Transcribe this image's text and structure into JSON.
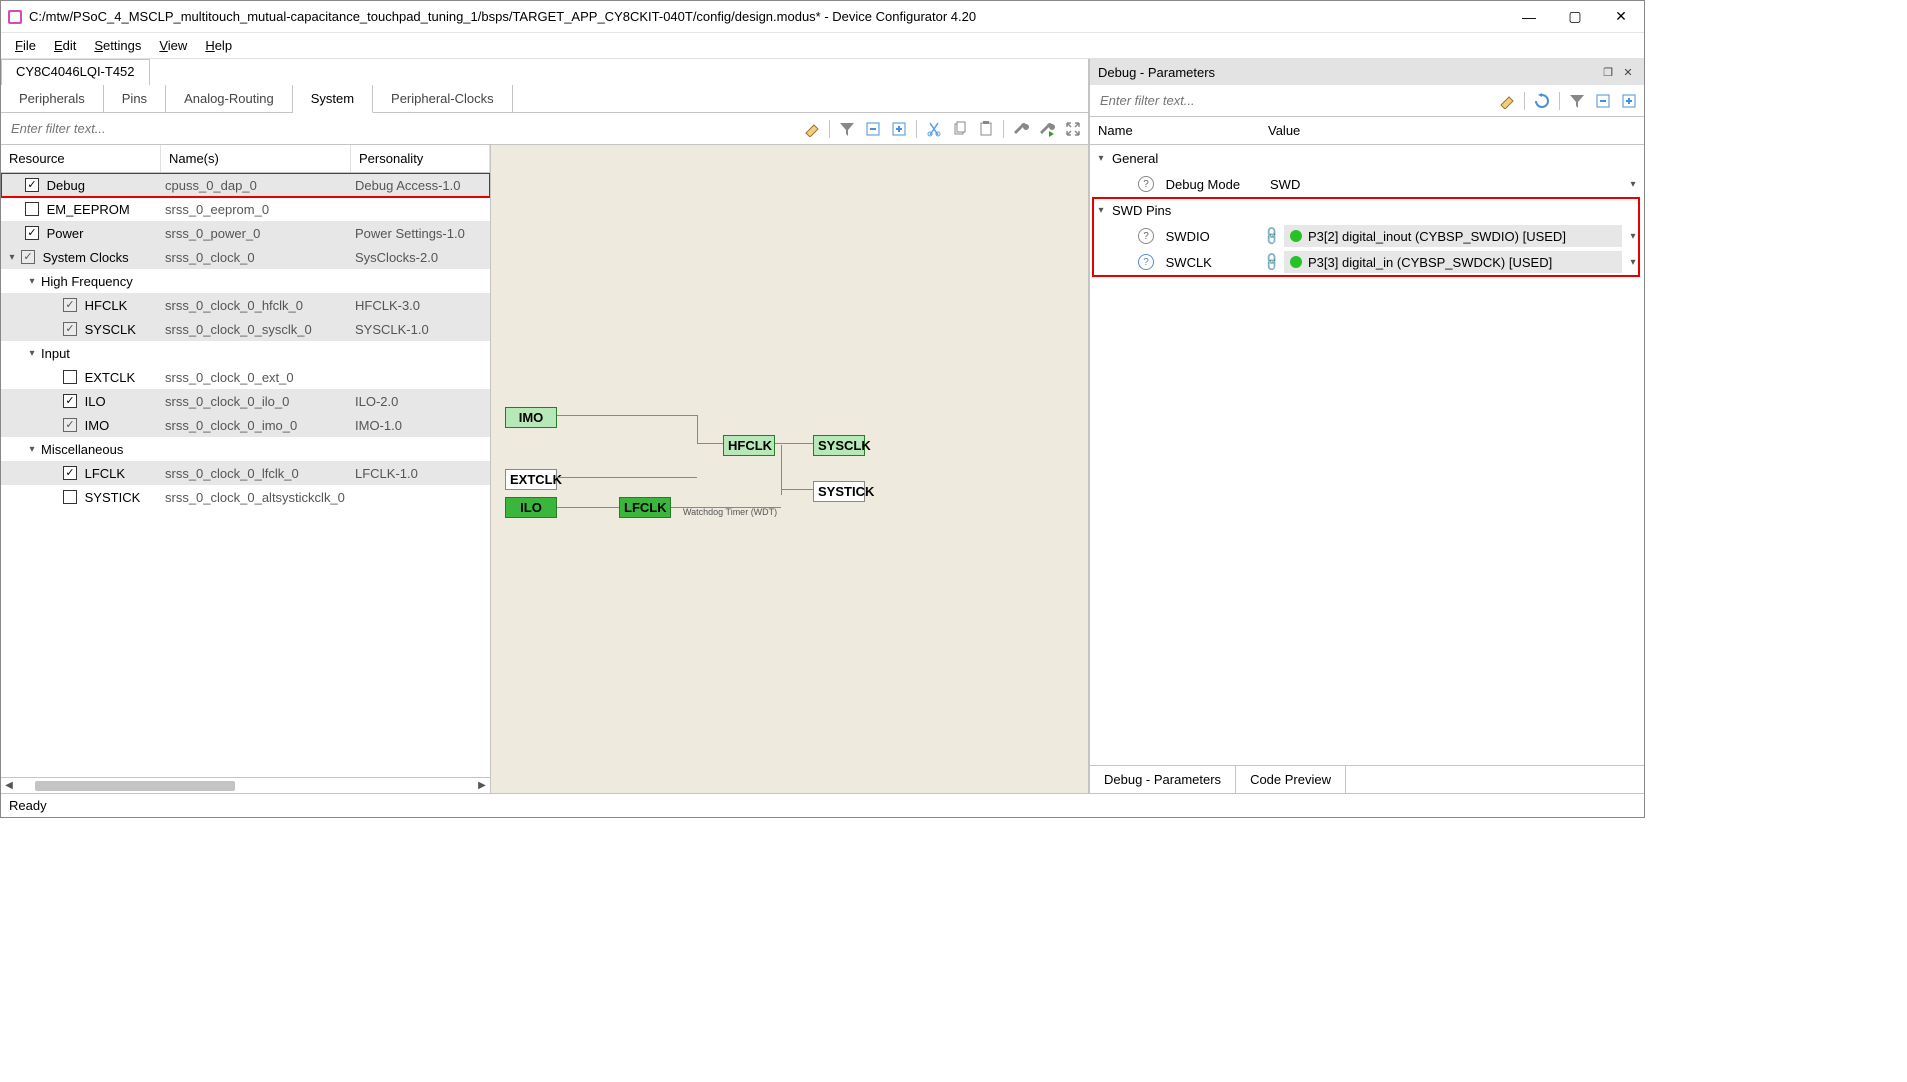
{
  "window": {
    "title": "C:/mtw/PSoC_4_MSCLP_multitouch_mutual-capacitance_touchpad_tuning_1/bsps/TARGET_APP_CY8CKIT-040T/config/design.modus* - Device Configurator 4.20"
  },
  "menubar": {
    "file": "File",
    "edit": "Edit",
    "settings": "Settings",
    "view": "View",
    "help": "Help"
  },
  "device_tab": "CY8C4046LQI-T452",
  "tabs": {
    "peripherals": "Peripherals",
    "pins": "Pins",
    "analog_routing": "Analog-Routing",
    "system": "System",
    "peripheral_clocks": "Peripheral-Clocks"
  },
  "left_filter_placeholder": "Enter filter text...",
  "tree_headers": {
    "resource": "Resource",
    "names": "Name(s)",
    "personality": "Personality"
  },
  "tree": {
    "debug": {
      "label": "Debug",
      "names": "cpuss_0_dap_0",
      "pers": "Debug Access-1.0"
    },
    "em_eeprom": {
      "label": "EM_EEPROM",
      "names": "srss_0_eeprom_0",
      "pers": ""
    },
    "power": {
      "label": "Power",
      "names": "srss_0_power_0",
      "pers": "Power Settings-1.0"
    },
    "system_clocks": {
      "label": "System Clocks",
      "names": "srss_0_clock_0",
      "pers": "SysClocks-2.0"
    },
    "high_freq": {
      "label": "High Frequency"
    },
    "hfclk": {
      "label": "HFCLK",
      "names": "srss_0_clock_0_hfclk_0",
      "pers": "HFCLK-3.0"
    },
    "sysclk": {
      "label": "SYSCLK",
      "names": "srss_0_clock_0_sysclk_0",
      "pers": "SYSCLK-1.0"
    },
    "input": {
      "label": "Input"
    },
    "extclk": {
      "label": "EXTCLK",
      "names": "srss_0_clock_0_ext_0",
      "pers": ""
    },
    "ilo": {
      "label": "ILO",
      "names": "srss_0_clock_0_ilo_0",
      "pers": "ILO-2.0"
    },
    "imo": {
      "label": "IMO",
      "names": "srss_0_clock_0_imo_0",
      "pers": "IMO-1.0"
    },
    "misc": {
      "label": "Miscellaneous"
    },
    "lfclk": {
      "label": "LFCLK",
      "names": "srss_0_clock_0_lfclk_0",
      "pers": "LFCLK-1.0"
    },
    "systick": {
      "label": "SYSTICK",
      "names": "srss_0_clock_0_altsystickclk_0",
      "pers": ""
    }
  },
  "canvas": {
    "imo": "IMO",
    "hfclk": "HFCLK",
    "sysclk": "SYSCLK",
    "extclk": "EXTCLK",
    "ilo": "ILO",
    "lfclk": "LFCLK",
    "systick": "SYSTICK",
    "wdt": "Watchdog Timer (WDT)"
  },
  "right": {
    "panel_title": "Debug - Parameters",
    "filter_placeholder": "Enter filter text...",
    "headers": {
      "name": "Name",
      "value": "Value"
    },
    "general": "General",
    "debug_mode_label": "Debug Mode",
    "debug_mode_value": "SWD",
    "swd_pins": "SWD Pins",
    "swdio_label": "SWDIO",
    "swdio_value": "P3[2] digital_inout (CYBSP_SWDIO) [USED]",
    "swclk_label": "SWCLK",
    "swclk_value": "P3[3] digital_in (CYBSP_SWDCK) [USED]",
    "bottom_tab_params": "Debug - Parameters",
    "bottom_tab_code": "Code Preview"
  },
  "statusbar": "Ready"
}
